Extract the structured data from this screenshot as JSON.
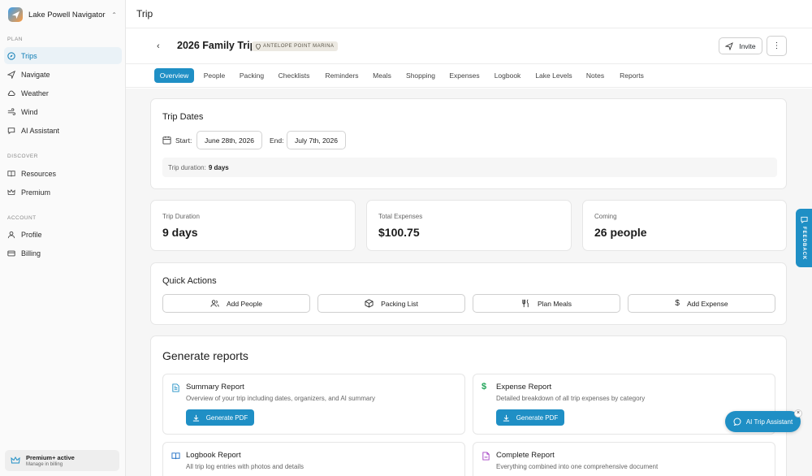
{
  "app": {
    "name": "Lake Powell Navigator"
  },
  "sidebar": {
    "sections": [
      {
        "label": "PLAN",
        "items": [
          {
            "label": "Trips",
            "icon": "compass-icon",
            "active": true
          },
          {
            "label": "Navigate",
            "icon": "navigate-icon"
          },
          {
            "label": "Weather",
            "icon": "weather-icon"
          },
          {
            "label": "Wind",
            "icon": "wind-icon"
          },
          {
            "label": "AI Assistant",
            "icon": "chat-icon"
          }
        ]
      },
      {
        "label": "DISCOVER",
        "items": [
          {
            "label": "Resources",
            "icon": "book-icon"
          },
          {
            "label": "Premium",
            "icon": "crown-icon"
          }
        ]
      },
      {
        "label": "ACCOUNT",
        "items": [
          {
            "label": "Profile",
            "icon": "user-icon"
          },
          {
            "label": "Billing",
            "icon": "card-icon"
          }
        ]
      }
    ],
    "premium": {
      "title": "Premium+ active",
      "subtitle": "Manage in billing"
    }
  },
  "header": {
    "title": "Trip"
  },
  "trip": {
    "title": "2026 Family Trip",
    "badge": "ANTELOPE POINT MARINA",
    "invite_label": "Invite"
  },
  "tabs": [
    "Overview",
    "People",
    "Packing",
    "Checklists",
    "Reminders",
    "Meals",
    "Shopping",
    "Expenses",
    "Logbook",
    "Lake Levels",
    "Notes",
    "Reports"
  ],
  "trip_dates": {
    "title": "Trip Dates",
    "start_label": "Start:",
    "start_value": "June 28th, 2026",
    "end_label": "End:",
    "end_value": "July 7th, 2026",
    "duration_label": "Trip duration:",
    "duration_value": "9 days"
  },
  "stats": [
    {
      "label": "Trip Duration",
      "value": "9 days"
    },
    {
      "label": "Total Expenses",
      "value": "$100.75"
    },
    {
      "label": "Coming",
      "value": "26 people"
    }
  ],
  "quick_actions": {
    "title": "Quick Actions",
    "buttons": [
      {
        "label": "Add People",
        "icon": "users-icon"
      },
      {
        "label": "Packing List",
        "icon": "package-icon"
      },
      {
        "label": "Plan Meals",
        "icon": "utensils-icon"
      },
      {
        "label": "Add Expense",
        "icon": "dollar-icon"
      }
    ]
  },
  "reports": {
    "title": "Generate reports",
    "pdf_label": "Generate PDF",
    "items": [
      {
        "title": "Summary Report",
        "desc": "Overview of your trip including dates, organizers, and AI summary",
        "icon": "file-text-icon",
        "color": "#1f8fc5"
      },
      {
        "title": "Expense Report",
        "desc": "Detailed breakdown of all trip expenses by category",
        "icon": "dollar-icon",
        "color": "#22a55a"
      },
      {
        "title": "Logbook Report",
        "desc": "All trip log entries with photos and details",
        "icon": "book-open-icon",
        "color": "#1f6fc5"
      },
      {
        "title": "Complete Report",
        "desc": "Everything combined into one comprehensive document",
        "icon": "file-icon",
        "color": "#a442c4"
      }
    ]
  },
  "feedback": {
    "label": "FEEDBACK"
  },
  "ai_assistant": {
    "label": "AI Trip Assistant"
  },
  "colors": {
    "accent": "#1f8fc5",
    "active_nav_bg": "#eaf2f7"
  }
}
